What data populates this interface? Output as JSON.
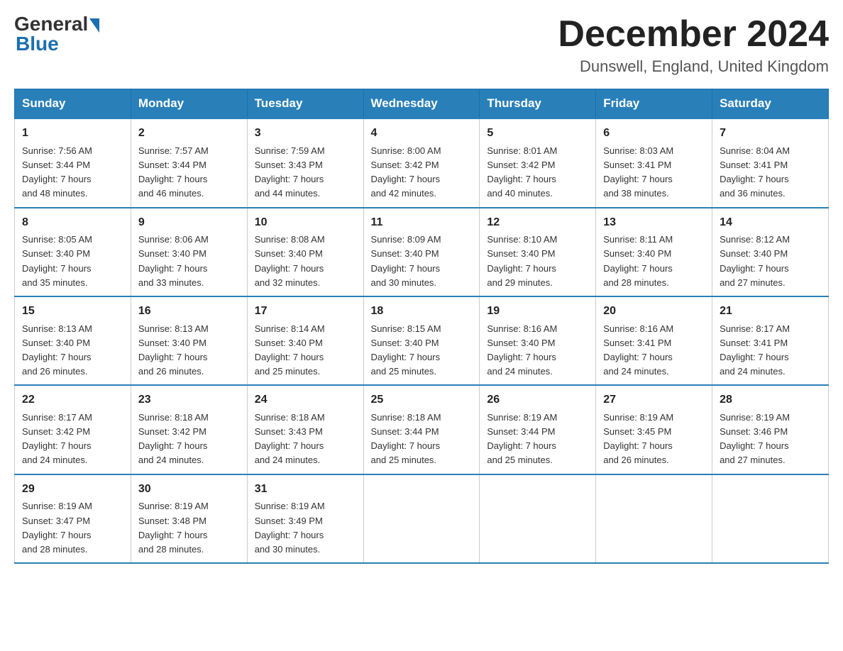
{
  "header": {
    "logo_general": "General",
    "logo_blue": "Blue",
    "month_title": "December 2024",
    "location": "Dunswell, England, United Kingdom"
  },
  "days_of_week": [
    "Sunday",
    "Monday",
    "Tuesday",
    "Wednesday",
    "Thursday",
    "Friday",
    "Saturday"
  ],
  "weeks": [
    [
      {
        "num": "1",
        "sunrise": "7:56 AM",
        "sunset": "3:44 PM",
        "daylight": "7 hours and 48 minutes."
      },
      {
        "num": "2",
        "sunrise": "7:57 AM",
        "sunset": "3:44 PM",
        "daylight": "7 hours and 46 minutes."
      },
      {
        "num": "3",
        "sunrise": "7:59 AM",
        "sunset": "3:43 PM",
        "daylight": "7 hours and 44 minutes."
      },
      {
        "num": "4",
        "sunrise": "8:00 AM",
        "sunset": "3:42 PM",
        "daylight": "7 hours and 42 minutes."
      },
      {
        "num": "5",
        "sunrise": "8:01 AM",
        "sunset": "3:42 PM",
        "daylight": "7 hours and 40 minutes."
      },
      {
        "num": "6",
        "sunrise": "8:03 AM",
        "sunset": "3:41 PM",
        "daylight": "7 hours and 38 minutes."
      },
      {
        "num": "7",
        "sunrise": "8:04 AM",
        "sunset": "3:41 PM",
        "daylight": "7 hours and 36 minutes."
      }
    ],
    [
      {
        "num": "8",
        "sunrise": "8:05 AM",
        "sunset": "3:40 PM",
        "daylight": "7 hours and 35 minutes."
      },
      {
        "num": "9",
        "sunrise": "8:06 AM",
        "sunset": "3:40 PM",
        "daylight": "7 hours and 33 minutes."
      },
      {
        "num": "10",
        "sunrise": "8:08 AM",
        "sunset": "3:40 PM",
        "daylight": "7 hours and 32 minutes."
      },
      {
        "num": "11",
        "sunrise": "8:09 AM",
        "sunset": "3:40 PM",
        "daylight": "7 hours and 30 minutes."
      },
      {
        "num": "12",
        "sunrise": "8:10 AM",
        "sunset": "3:40 PM",
        "daylight": "7 hours and 29 minutes."
      },
      {
        "num": "13",
        "sunrise": "8:11 AM",
        "sunset": "3:40 PM",
        "daylight": "7 hours and 28 minutes."
      },
      {
        "num": "14",
        "sunrise": "8:12 AM",
        "sunset": "3:40 PM",
        "daylight": "7 hours and 27 minutes."
      }
    ],
    [
      {
        "num": "15",
        "sunrise": "8:13 AM",
        "sunset": "3:40 PM",
        "daylight": "7 hours and 26 minutes."
      },
      {
        "num": "16",
        "sunrise": "8:13 AM",
        "sunset": "3:40 PM",
        "daylight": "7 hours and 26 minutes."
      },
      {
        "num": "17",
        "sunrise": "8:14 AM",
        "sunset": "3:40 PM",
        "daylight": "7 hours and 25 minutes."
      },
      {
        "num": "18",
        "sunrise": "8:15 AM",
        "sunset": "3:40 PM",
        "daylight": "7 hours and 25 minutes."
      },
      {
        "num": "19",
        "sunrise": "8:16 AM",
        "sunset": "3:40 PM",
        "daylight": "7 hours and 24 minutes."
      },
      {
        "num": "20",
        "sunrise": "8:16 AM",
        "sunset": "3:41 PM",
        "daylight": "7 hours and 24 minutes."
      },
      {
        "num": "21",
        "sunrise": "8:17 AM",
        "sunset": "3:41 PM",
        "daylight": "7 hours and 24 minutes."
      }
    ],
    [
      {
        "num": "22",
        "sunrise": "8:17 AM",
        "sunset": "3:42 PM",
        "daylight": "7 hours and 24 minutes."
      },
      {
        "num": "23",
        "sunrise": "8:18 AM",
        "sunset": "3:42 PM",
        "daylight": "7 hours and 24 minutes."
      },
      {
        "num": "24",
        "sunrise": "8:18 AM",
        "sunset": "3:43 PM",
        "daylight": "7 hours and 24 minutes."
      },
      {
        "num": "25",
        "sunrise": "8:18 AM",
        "sunset": "3:44 PM",
        "daylight": "7 hours and 25 minutes."
      },
      {
        "num": "26",
        "sunrise": "8:19 AM",
        "sunset": "3:44 PM",
        "daylight": "7 hours and 25 minutes."
      },
      {
        "num": "27",
        "sunrise": "8:19 AM",
        "sunset": "3:45 PM",
        "daylight": "7 hours and 26 minutes."
      },
      {
        "num": "28",
        "sunrise": "8:19 AM",
        "sunset": "3:46 PM",
        "daylight": "7 hours and 27 minutes."
      }
    ],
    [
      {
        "num": "29",
        "sunrise": "8:19 AM",
        "sunset": "3:47 PM",
        "daylight": "7 hours and 28 minutes."
      },
      {
        "num": "30",
        "sunrise": "8:19 AM",
        "sunset": "3:48 PM",
        "daylight": "7 hours and 28 minutes."
      },
      {
        "num": "31",
        "sunrise": "8:19 AM",
        "sunset": "3:49 PM",
        "daylight": "7 hours and 30 minutes."
      },
      null,
      null,
      null,
      null
    ]
  ],
  "labels": {
    "sunrise": "Sunrise:",
    "sunset": "Sunset:",
    "daylight": "Daylight:"
  }
}
